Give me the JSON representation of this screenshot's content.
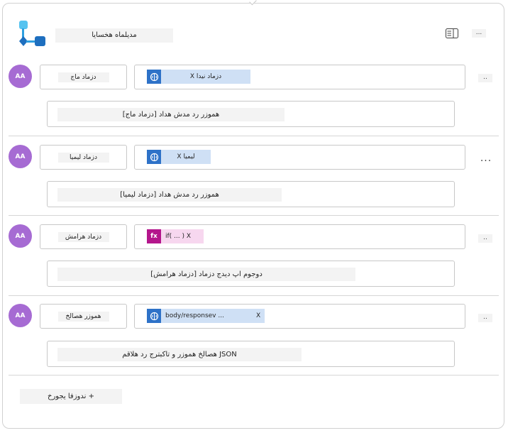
{
  "header": {
    "title": "مدیلماه هخسایا",
    "icon": "flow-nodes-icon",
    "panel_icon": "side-panel-icon",
    "more_label": "..."
  },
  "rows": [
    {
      "avatar": "AA",
      "name": "دزماد ماج",
      "token": {
        "icon": "ai-brain-icon",
        "text": "دزماد نیدا X"
      },
      "description": "هموزر رد مدش هداد [دزماد ماج]",
      "more": ".."
    },
    {
      "avatar": "AA",
      "name": "دزماد لیمیا",
      "token": {
        "icon": "ai-brain-icon",
        "text": "لیمیا X"
      },
      "description": "هموزر رد مدش هداد [دزماد لیمیا]",
      "more": "..."
    },
    {
      "avatar": "AA",
      "name": "دزماد هرامش",
      "token": {
        "icon": "fx-icon",
        "icon_label": "fx",
        "text": "if( ... ) X"
      },
      "description": "دوجوم اپ دیدج دزماد [دزماد هرامش]",
      "more": ".."
    },
    {
      "avatar": "AA",
      "name": "هموزر هصالخ",
      "token": {
        "icon": "ai-brain-icon",
        "text": "body/responsev ...",
        "close": "X"
      },
      "description": "JSON هصالخ هموزر و تاکبترج رد هلاقم",
      "more": ".."
    }
  ],
  "add_button": "+ ندوزفا یجورخ",
  "colors": {
    "avatar": "#a66bd3",
    "token_blue": "#2e72c8",
    "token_blue_bg": "#cfe0f5",
    "token_magenta": "#b4168c",
    "token_magenta_bg": "#f7d7ef",
    "border": "#c8c8c8"
  }
}
